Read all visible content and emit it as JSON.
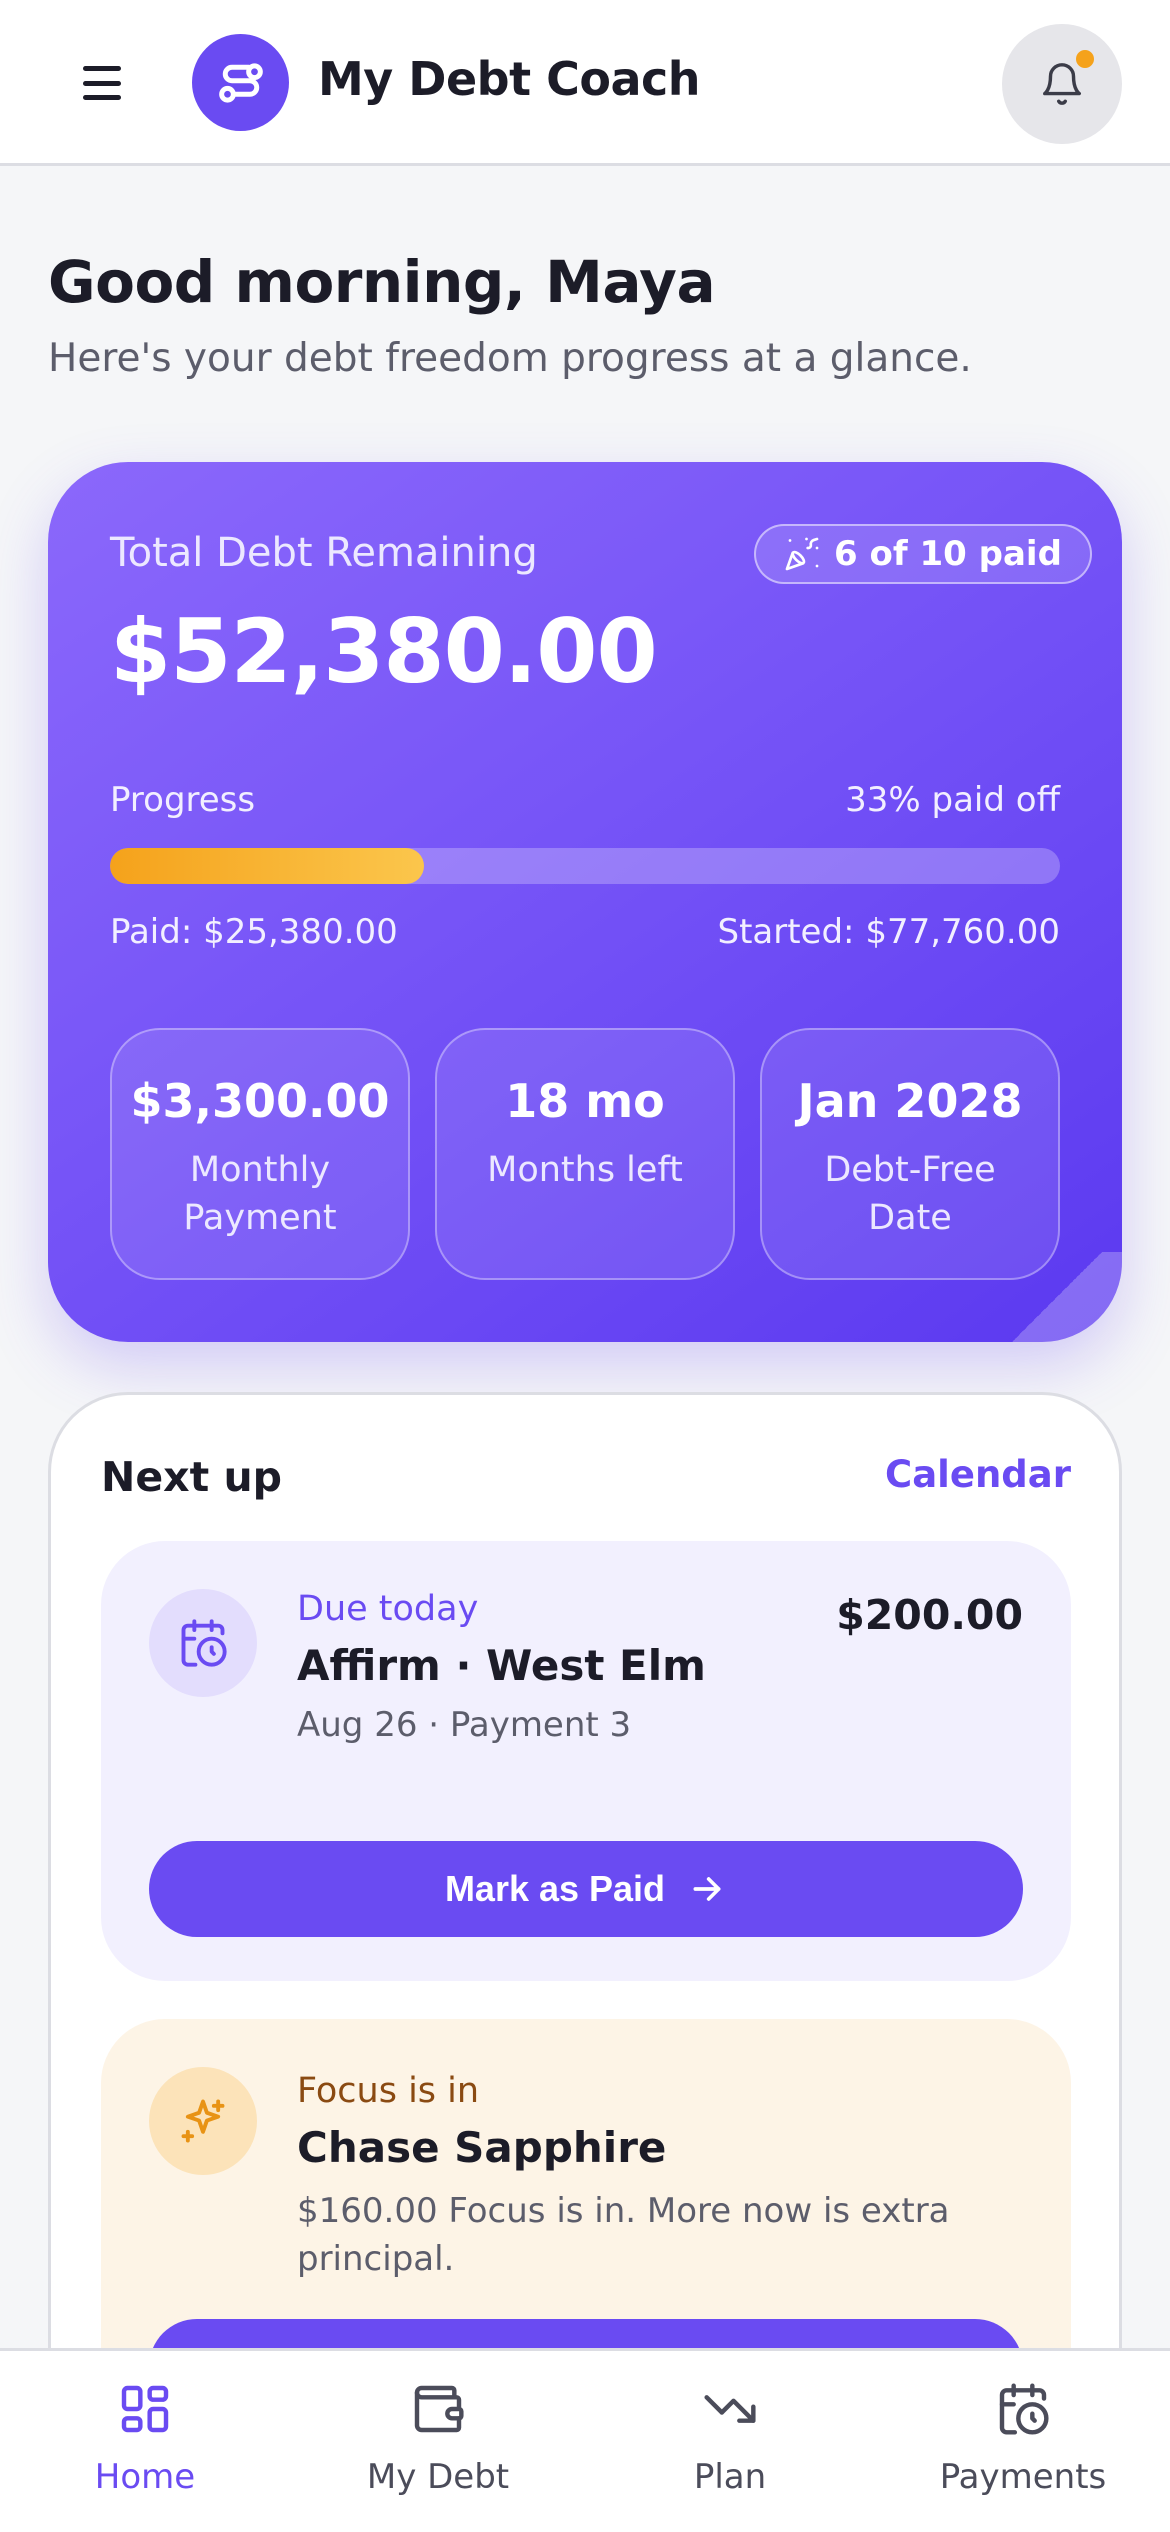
{
  "header": {
    "app_title": "My Debt Coach",
    "menu_icon": "menu-icon",
    "logo_icon": "route-icon",
    "notification_icon": "bell-icon",
    "notification_dot_color": "#f5a21b"
  },
  "greeting": {
    "title": "Good morning, Maya",
    "subtitle": "Here's your debt freedom progress at a glance."
  },
  "debt_card": {
    "label": "Total Debt Remaining",
    "badge": "6 of 10 paid",
    "badge_icon": "party-popper-icon",
    "total": "$52,380.00",
    "progress_label": "Progress",
    "progress_percent_text": "33% paid off",
    "progress_value": 0.33,
    "paid_text": "Paid: $25,380.00",
    "started_text": "Started: $77,760.00",
    "stats": [
      {
        "value": "$3,300.00",
        "label": "Monthly Payment"
      },
      {
        "value": "18 mo",
        "label": "Months left"
      },
      {
        "value": "Jan 2028",
        "label": "Debt-Free Date"
      }
    ]
  },
  "next_up": {
    "title": "Next up",
    "calendar_link": "Calendar",
    "due_item": {
      "icon": "calendar-clock-icon",
      "status": "Due today",
      "name": "Affirm · West Elm",
      "meta": "Aug 26 · Payment 3",
      "amount": "$200.00",
      "button_label": "Mark as Paid"
    },
    "focus_item": {
      "icon": "sparkles-icon",
      "status": "Focus is in",
      "name": "Chase Sapphire",
      "description": "$160.00 Focus is in. More now is extra principal."
    }
  },
  "bottom_nav": {
    "items": [
      {
        "label": "Home",
        "icon": "grid-icon",
        "active": true
      },
      {
        "label": "My Debt",
        "icon": "wallet-icon",
        "active": false
      },
      {
        "label": "Plan",
        "icon": "trend-down-icon",
        "active": false
      },
      {
        "label": "Payments",
        "icon": "calendar-clock-icon",
        "active": false
      }
    ]
  },
  "colors": {
    "accent": "#6a4bf2",
    "progress": "#f5a21b",
    "focus_bg": "#fdf4e6"
  }
}
